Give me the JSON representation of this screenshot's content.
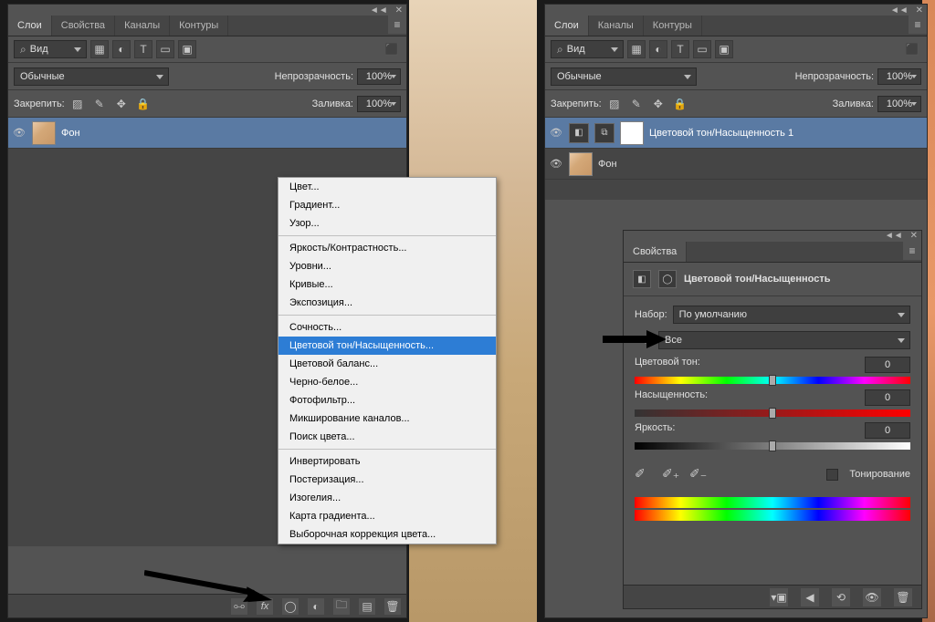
{
  "left_panel": {
    "tabs": [
      "Слои",
      "Свойства",
      "Каналы",
      "Контуры"
    ],
    "active_tab": 0,
    "filter_kind": "Вид",
    "blend_mode": "Обычные",
    "opacity_label": "Непрозрачность:",
    "opacity_value": "100%",
    "lock_label": "Закрепить:",
    "fill_label": "Заливка:",
    "fill_value": "100%",
    "layers": [
      {
        "name": "Фон",
        "visible": true,
        "selected": true,
        "thumb": "face"
      }
    ]
  },
  "right_panel": {
    "tabs": [
      "Слои",
      "Каналы",
      "Контуры"
    ],
    "active_tab": 0,
    "filter_kind": "Вид",
    "blend_mode": "Обычные",
    "opacity_label": "Непрозрачность:",
    "opacity_value": "100%",
    "lock_label": "Закрепить:",
    "fill_label": "Заливка:",
    "fill_value": "100%",
    "layers": [
      {
        "name": "Цветовой тон/Насыщенность 1",
        "visible": true,
        "selected": true,
        "type": "adjustment"
      },
      {
        "name": "Фон",
        "visible": true,
        "selected": false,
        "thumb": "face"
      }
    ]
  },
  "context_menu": {
    "groups": [
      [
        "Цвет...",
        "Градиент...",
        "Узор..."
      ],
      [
        "Яркость/Контрастность...",
        "Уровни...",
        "Кривые...",
        "Экспозиция..."
      ],
      [
        "Сочность...",
        "Цветовой тон/Насыщенность...",
        "Цветовой баланс...",
        "Черно-белое...",
        "Фотофильтр...",
        "Микширование каналов...",
        "Поиск цвета..."
      ],
      [
        "Инвертировать",
        "Постеризация...",
        "Изогелия...",
        "Карта градиента...",
        "Выборочная коррекция цвета..."
      ]
    ],
    "highlighted": "Цветовой тон/Насыщенность..."
  },
  "properties": {
    "tab": "Свойства",
    "title": "Цветовой тон/Насыщенность",
    "preset_label": "Набор:",
    "preset_value": "По умолчанию",
    "range_value": "Все",
    "hue_label": "Цветовой тон:",
    "hue_value": "0",
    "sat_label": "Насыщенность:",
    "sat_value": "0",
    "lig_label": "Яркость:",
    "lig_value": "0",
    "colorize_label": "Тонирование"
  }
}
